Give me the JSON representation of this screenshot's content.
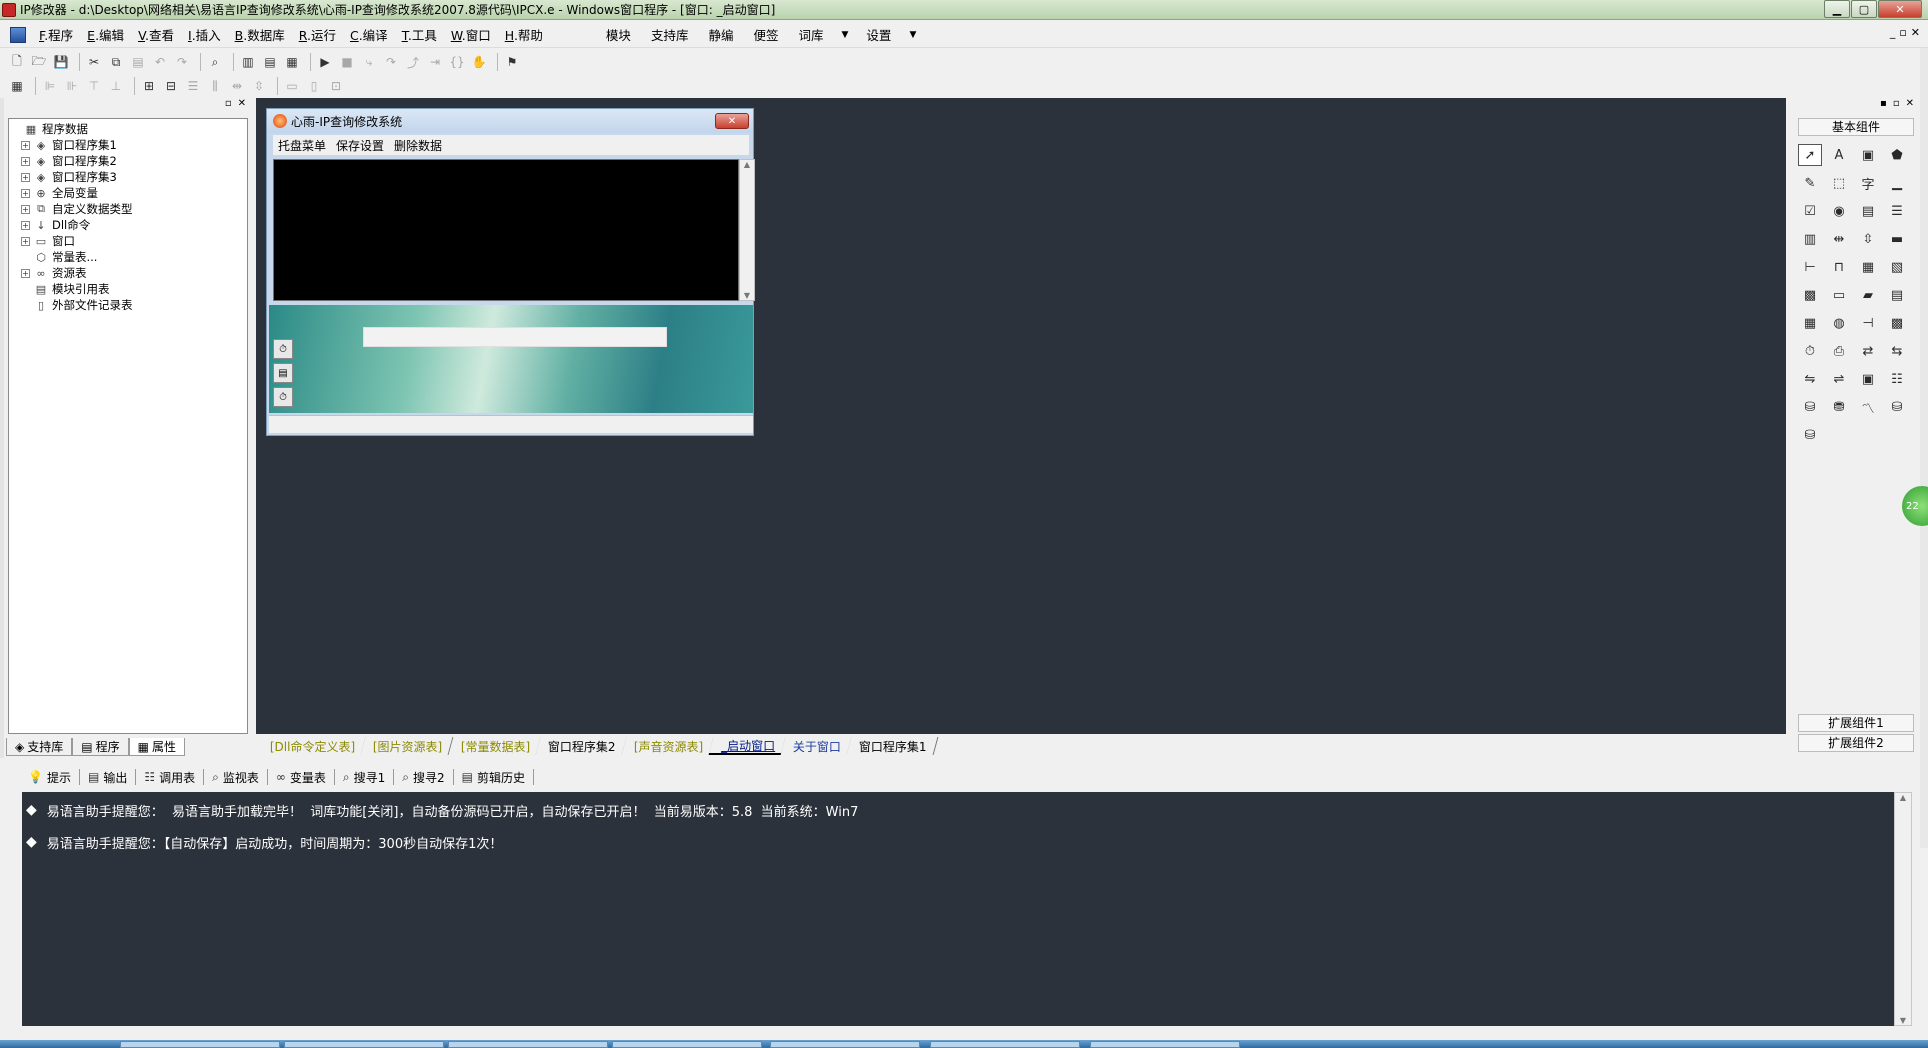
{
  "window": {
    "title": "IP修改器 - d:\\Desktop\\网络相关\\易语言IP查询修改系统\\心雨-IP查询修改系统2007.8源代码\\IPCX.e - Windows窗口程序 - [窗口: _启动窗口]",
    "min_label": "▁",
    "max_label": "▢",
    "close_label": "✕"
  },
  "menu": {
    "items": [
      {
        "key": "F",
        "label": ".程序"
      },
      {
        "key": "E",
        "label": ".编辑"
      },
      {
        "key": "V",
        "label": ".查看"
      },
      {
        "key": "I",
        "label": ".插入"
      },
      {
        "key": "B",
        "label": ".数据库"
      },
      {
        "key": "R",
        "label": ".运行"
      },
      {
        "key": "C",
        "label": ".编译"
      },
      {
        "key": "T",
        "label": ".工具"
      },
      {
        "key": "W",
        "label": ".窗口"
      },
      {
        "key": "H",
        "label": ".帮助"
      }
    ],
    "extra": [
      "模块",
      "支持库",
      "静编",
      "便签",
      "词库",
      "设置"
    ],
    "mdi_buttons": [
      "_",
      "▫",
      "✕"
    ]
  },
  "left_panel": {
    "tree": [
      {
        "label": "程序数据",
        "expand": "",
        "icon": "program-data-icon",
        "glyph": "▦",
        "level": 0
      },
      {
        "label": "窗口程序集1",
        "expand": "+",
        "icon": "module-icon",
        "glyph": "◈",
        "level": 1
      },
      {
        "label": "窗口程序集2",
        "expand": "+",
        "icon": "module-icon",
        "glyph": "◈",
        "level": 1
      },
      {
        "label": "窗口程序集3",
        "expand": "+",
        "icon": "module-icon",
        "glyph": "◈",
        "level": 1
      },
      {
        "label": "全局变量",
        "expand": "+",
        "icon": "global-var-icon",
        "glyph": "⊕",
        "level": 1
      },
      {
        "label": "自定义数据类型",
        "expand": "+",
        "icon": "datatype-icon",
        "glyph": "⧉",
        "level": 1
      },
      {
        "label": "Dll命令",
        "expand": "+",
        "icon": "dll-icon",
        "glyph": "↓",
        "level": 1
      },
      {
        "label": "窗口",
        "expand": "+",
        "icon": "window-icon",
        "glyph": "▭",
        "level": 1
      },
      {
        "label": "常量表...",
        "expand": "",
        "icon": "constant-icon",
        "glyph": "⬡",
        "level": 1
      },
      {
        "label": "资源表",
        "expand": "+",
        "icon": "resource-icon",
        "glyph": "∞",
        "level": 1
      },
      {
        "label": "模块引用表",
        "expand": "",
        "icon": "module-ref-icon",
        "glyph": "▤",
        "level": 1
      },
      {
        "label": "外部文件记录表",
        "expand": "",
        "icon": "file-icon",
        "glyph": "▯",
        "level": 1
      }
    ],
    "tabs": [
      "支持库",
      "程序",
      "属性"
    ]
  },
  "editor_tabs": [
    {
      "label": "[Dll命令定义表]",
      "style": "yellow"
    },
    {
      "label": "[图片资源表]",
      "style": "yellow"
    },
    {
      "label": "[常量数据表]",
      "style": "yellow"
    },
    {
      "label": "窗口程序集2",
      "style": "normal"
    },
    {
      "label": "[声音资源表]",
      "style": "yellow"
    },
    {
      "label": "_启动窗口",
      "style": "active"
    },
    {
      "label": "关于窗口",
      "style": "blue"
    },
    {
      "label": "窗口程序集1",
      "style": "normal"
    }
  ],
  "form": {
    "title": "心雨-IP查询修改系统",
    "close_label": "✕",
    "menu": [
      "托盘菜单",
      "保存设置",
      "删除数据"
    ],
    "timer_glyphs": [
      "⏱",
      "▤",
      "⏱"
    ]
  },
  "right_panel": {
    "title": "基本组件",
    "components": [
      {
        "name": "pointer-icon",
        "glyph": "➚"
      },
      {
        "name": "label-component-icon",
        "glyph": "A"
      },
      {
        "name": "picture-box-icon",
        "glyph": "▣"
      },
      {
        "name": "shape-icon",
        "glyph": "⬟"
      },
      {
        "name": "drawing-board-icon",
        "glyph": "✎"
      },
      {
        "name": "group-box-icon",
        "glyph": "⬚"
      },
      {
        "name": "label-text-icon",
        "glyph": "字"
      },
      {
        "name": "button-icon",
        "glyph": "▁"
      },
      {
        "name": "checkbox-icon",
        "glyph": "☑"
      },
      {
        "name": "radio-icon",
        "glyph": "◉"
      },
      {
        "name": "combobox-icon",
        "glyph": "▤"
      },
      {
        "name": "listbox-icon",
        "glyph": "☰"
      },
      {
        "name": "checklist-icon",
        "glyph": "▥"
      },
      {
        "name": "hscroll-icon",
        "glyph": "⇹"
      },
      {
        "name": "vscroll-icon",
        "glyph": "⇳"
      },
      {
        "name": "progress-icon",
        "glyph": "▬"
      },
      {
        "name": "slider-icon",
        "glyph": "⊢"
      },
      {
        "name": "tab-control-icon",
        "glyph": "⊓"
      },
      {
        "name": "animation-icon",
        "glyph": "▦"
      },
      {
        "name": "calendar-icon",
        "glyph": "▧"
      },
      {
        "name": "grid-icon",
        "glyph": "▩"
      },
      {
        "name": "edit-box-icon",
        "glyph": "▭"
      },
      {
        "name": "image-list-icon",
        "glyph": "▰"
      },
      {
        "name": "rich-text-icon",
        "glyph": "▤"
      },
      {
        "name": "tree-view-icon",
        "glyph": "▦"
      },
      {
        "name": "globe-icon",
        "glyph": "◍"
      },
      {
        "name": "splitter-icon",
        "glyph": "⊣"
      },
      {
        "name": "data-grid-icon",
        "glyph": "▩"
      },
      {
        "name": "timer-icon",
        "glyph": "⏱"
      },
      {
        "name": "printer-icon",
        "glyph": "⎙"
      },
      {
        "name": "network-icon",
        "glyph": "⇄"
      },
      {
        "name": "server-icon",
        "glyph": "⇆"
      },
      {
        "name": "client-icon",
        "glyph": "⇋"
      },
      {
        "name": "port-icon",
        "glyph": "⇌"
      },
      {
        "name": "window-frame-icon",
        "glyph": "▣"
      },
      {
        "name": "toolbar-icon",
        "glyph": "☷"
      },
      {
        "name": "database-icon",
        "glyph": "⛁"
      },
      {
        "name": "db-provider-icon",
        "glyph": "⛃"
      },
      {
        "name": "chart-icon",
        "glyph": "〽"
      },
      {
        "name": "odbc-icon",
        "glyph": "⛁"
      },
      {
        "name": "odbc-db-icon",
        "glyph": "⛁"
      }
    ],
    "ext1": "扩展组件1",
    "ext2": "扩展组件2"
  },
  "bottom_tabs": [
    {
      "label": "提示",
      "icon": "hint-icon",
      "glyph": "💡"
    },
    {
      "label": "输出",
      "icon": "output-icon",
      "glyph": "▤"
    },
    {
      "label": "调用表",
      "icon": "callstack-icon",
      "glyph": "☷"
    },
    {
      "label": "监视表",
      "icon": "watch-icon",
      "glyph": "⌕"
    },
    {
      "label": "变量表",
      "icon": "variable-icon",
      "glyph": "∞"
    },
    {
      "label": "搜寻1",
      "icon": "search1-icon",
      "glyph": "⌕"
    },
    {
      "label": "搜寻2",
      "icon": "search2-icon",
      "glyph": "⌕"
    },
    {
      "label": "剪辑历史",
      "icon": "clip-history-icon",
      "glyph": "▤"
    }
  ],
  "output": [
    "易语言助手提醒您：  易语言助手加载完毕！  词库功能[关闭]，自动备份源码已开启，自动保存已开启！  当前易版本：5.8  当前系统：Win7",
    "易语言助手提醒您：【自动保存】启动成功，时间周期为：300秒自动保存1次！"
  ],
  "float_badge": "22"
}
